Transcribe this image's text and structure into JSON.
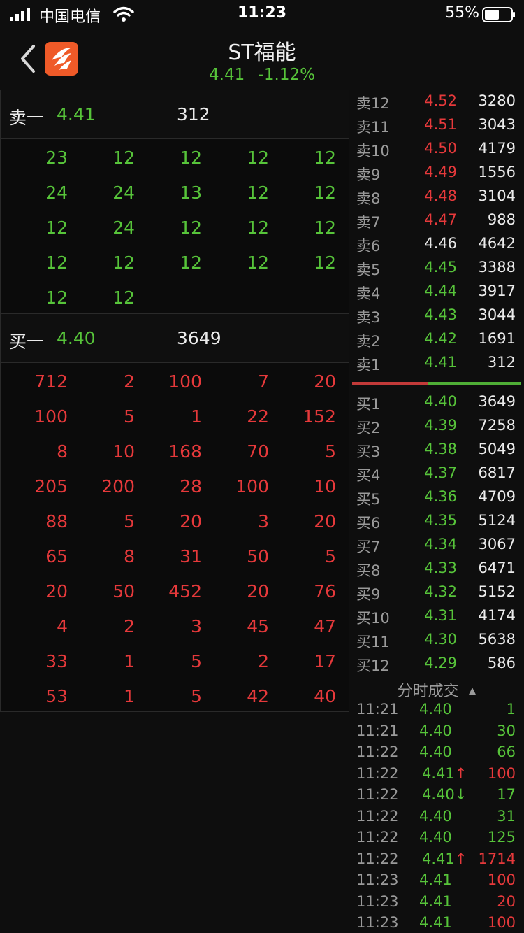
{
  "status_bar": {
    "carrier": "中国电信",
    "time": "11:23",
    "battery": "55%"
  },
  "header": {
    "title": "ST福能",
    "price": "4.41",
    "change": "-1.12%"
  },
  "sell_level": {
    "label": "卖一",
    "price": "4.41",
    "volume": "312"
  },
  "sell_orders": [
    [
      "23",
      "12",
      "12",
      "12",
      "12"
    ],
    [
      "24",
      "24",
      "13",
      "12",
      "12"
    ],
    [
      "12",
      "24",
      "12",
      "12",
      "12"
    ],
    [
      "12",
      "12",
      "12",
      "12",
      "12"
    ],
    [
      "12",
      "12"
    ]
  ],
  "buy_level": {
    "label": "买一",
    "price": "4.40",
    "volume": "3649"
  },
  "buy_orders": [
    [
      "712",
      "2",
      "100",
      "7",
      "20"
    ],
    [
      "100",
      "5",
      "1",
      "22",
      "152"
    ],
    [
      "8",
      "10",
      "168",
      "70",
      "5"
    ],
    [
      "205",
      "200",
      "28",
      "100",
      "10"
    ],
    [
      "88",
      "5",
      "20",
      "3",
      "20"
    ],
    [
      "65",
      "8",
      "31",
      "50",
      "5"
    ],
    [
      "20",
      "50",
      "452",
      "20",
      "76"
    ],
    [
      "4",
      "2",
      "3",
      "45",
      "47"
    ],
    [
      "33",
      "1",
      "5",
      "2",
      "17"
    ],
    [
      "53",
      "1",
      "5",
      "42",
      "40"
    ]
  ],
  "ask_book": [
    {
      "level": "卖12",
      "price": "4.52",
      "volume": "3280",
      "color": "#e6393b"
    },
    {
      "level": "卖11",
      "price": "4.51",
      "volume": "3043",
      "color": "#e6393b"
    },
    {
      "level": "卖10",
      "price": "4.50",
      "volume": "4179",
      "color": "#e6393b"
    },
    {
      "level": "卖9",
      "price": "4.49",
      "volume": "1556",
      "color": "#e6393b"
    },
    {
      "level": "卖8",
      "price": "4.48",
      "volume": "3104",
      "color": "#e6393b"
    },
    {
      "level": "卖7",
      "price": "4.47",
      "volume": "988",
      "color": "#e6393b"
    },
    {
      "level": "卖6",
      "price": "4.46",
      "volume": "4642",
      "color": "#e8e8e8"
    },
    {
      "level": "卖5",
      "price": "4.45",
      "volume": "3388",
      "color": "#57c43a"
    },
    {
      "level": "卖4",
      "price": "4.44",
      "volume": "3917",
      "color": "#57c43a"
    },
    {
      "level": "卖3",
      "price": "4.43",
      "volume": "3044",
      "color": "#57c43a"
    },
    {
      "level": "卖2",
      "price": "4.42",
      "volume": "1691",
      "color": "#57c43a"
    },
    {
      "level": "卖1",
      "price": "4.41",
      "volume": "312",
      "color": "#57c43a"
    }
  ],
  "bid_book": [
    {
      "level": "买1",
      "price": "4.40",
      "volume": "3649"
    },
    {
      "level": "买2",
      "price": "4.39",
      "volume": "7258"
    },
    {
      "level": "买3",
      "price": "4.38",
      "volume": "5049"
    },
    {
      "level": "买4",
      "price": "4.37",
      "volume": "6817"
    },
    {
      "level": "买5",
      "price": "4.36",
      "volume": "4709"
    },
    {
      "level": "买6",
      "price": "4.35",
      "volume": "5124"
    },
    {
      "level": "买7",
      "price": "4.34",
      "volume": "3067"
    },
    {
      "level": "买8",
      "price": "4.33",
      "volume": "6471"
    },
    {
      "level": "买9",
      "price": "4.32",
      "volume": "5152"
    },
    {
      "level": "买10",
      "price": "4.31",
      "volume": "4174"
    },
    {
      "level": "买11",
      "price": "4.30",
      "volume": "5638"
    },
    {
      "level": "买12",
      "price": "4.29",
      "volume": "586"
    }
  ],
  "ticks": {
    "title": "分时成交",
    "rows": [
      {
        "time": "11:21",
        "price": "4.40",
        "volume": "1",
        "vol_color": "#57c43a"
      },
      {
        "time": "11:21",
        "price": "4.40",
        "volume": "30",
        "vol_color": "#57c43a"
      },
      {
        "time": "11:22",
        "price": "4.40",
        "volume": "66",
        "vol_color": "#57c43a"
      },
      {
        "time": "11:22",
        "price": "4.41↑",
        "volume": "100",
        "vol_color": "#e6393b"
      },
      {
        "time": "11:22",
        "price": "4.40↓",
        "volume": "17",
        "vol_color": "#57c43a"
      },
      {
        "time": "11:22",
        "price": "4.40",
        "volume": "31",
        "vol_color": "#57c43a"
      },
      {
        "time": "11:22",
        "price": "4.40",
        "volume": "125",
        "vol_color": "#57c43a"
      },
      {
        "time": "11:22",
        "price": "4.41↑",
        "volume": "1714",
        "vol_color": "#e6393b"
      },
      {
        "time": "11:23",
        "price": "4.41",
        "volume": "100",
        "vol_color": "#e6393b"
      },
      {
        "time": "11:23",
        "price": "4.41",
        "volume": "20",
        "vol_color": "#e6393b"
      },
      {
        "time": "11:23",
        "price": "4.41",
        "volume": "100",
        "vol_color": "#e6393b"
      }
    ]
  }
}
